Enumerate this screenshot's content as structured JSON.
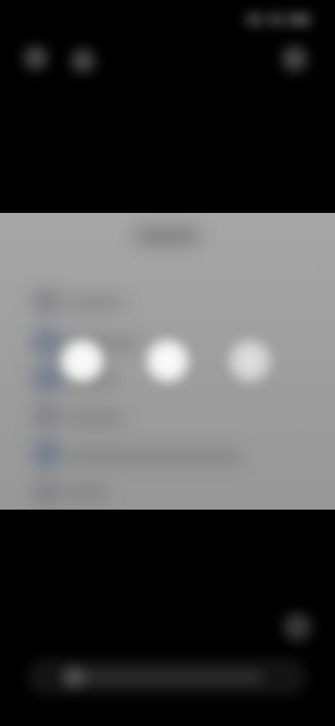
{
  "status_bar": {
    "time": "",
    "icons": [
      "signal-icon",
      "wifi-icon",
      "battery-icon"
    ]
  },
  "top_actions": {
    "left_icons": [
      "back-icon",
      "menu-icon"
    ],
    "right_icon": "more-icon"
  },
  "media": {
    "state": "loading",
    "title": "",
    "rows": [
      {
        "icon": "app-icon"
      },
      {
        "icon": "app-icon"
      },
      {
        "icon": "app-icon"
      },
      {
        "icon": "app-icon"
      },
      {
        "icon": "app-icon"
      },
      {
        "icon": "app-icon"
      }
    ],
    "loading_indicator": "three-dot-loader-icon"
  },
  "bottom_bar": {
    "action_icon": "action-icon",
    "input_placeholder": ""
  },
  "colors": {
    "background": "#000000",
    "frame_background": "#a0a0a0",
    "row_icon": "#5f6f86"
  }
}
